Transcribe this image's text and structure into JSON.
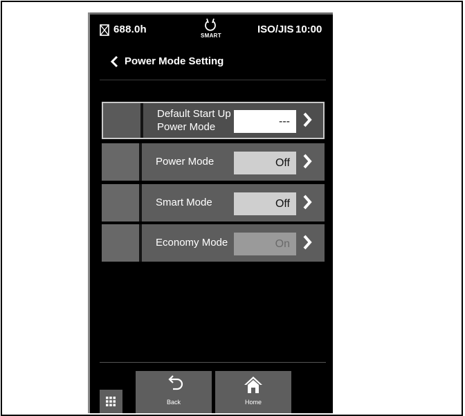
{
  "status_bar": {
    "hours": "688.0h",
    "smart_label": "SMART",
    "standard": "ISO/JIS",
    "clock": "10:00"
  },
  "header": {
    "title": "Power Mode Setting"
  },
  "settings": [
    {
      "label_line1": "Default Start Up",
      "label_line2": "Power Mode",
      "value": "---"
    },
    {
      "label_line1": "Power Mode",
      "value": "Off"
    },
    {
      "label_line1": "Smart Mode",
      "value": "Off"
    },
    {
      "label_line1": "Economy Mode",
      "value": "On"
    }
  ],
  "bottom_nav": {
    "back_label": "Back",
    "home_label": "Home"
  },
  "icons": {
    "hourglass": "hourglass-icon",
    "smart": "smart-engine-icon",
    "back_chevron": "chevron-left-icon",
    "row_chevron": "chevron-right-icon",
    "back": "undo-arrow-icon",
    "home": "home-icon",
    "menu": "grid-icon"
  }
}
